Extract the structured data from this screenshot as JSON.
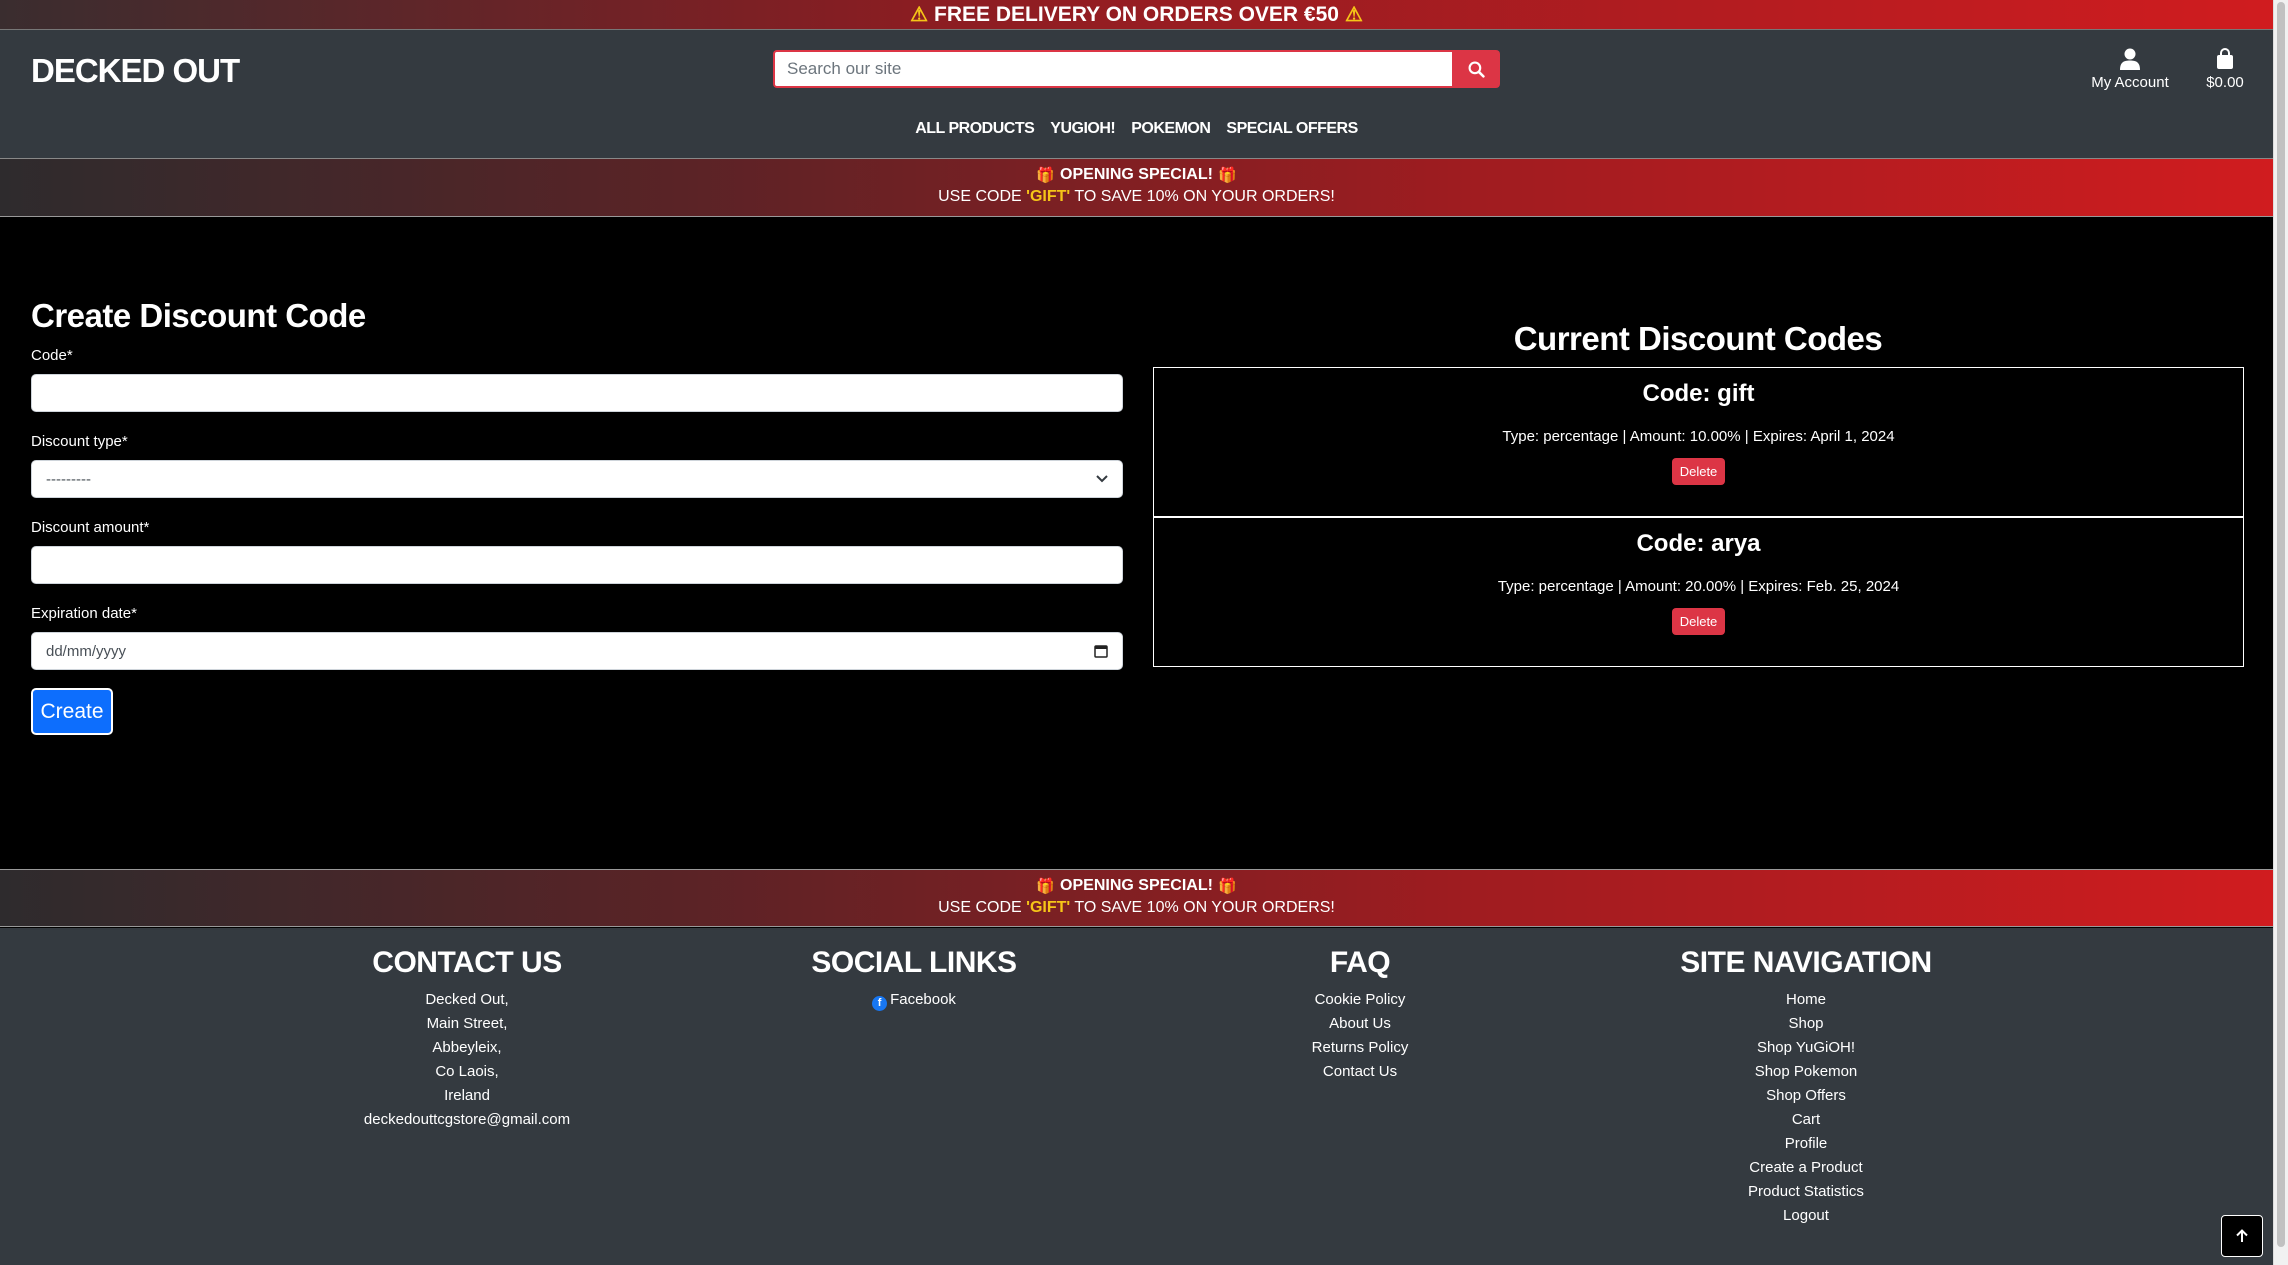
{
  "delivery_bar": {
    "text": "FREE DELIVERY ON ORDERS OVER €50",
    "icon": "warning-icon"
  },
  "header": {
    "logo": "DECKED OUT",
    "search": {
      "placeholder": "Search our site",
      "value": ""
    },
    "account_label": "My Account",
    "cart_total": "$0.00",
    "nav": [
      "ALL PRODUCTS",
      "YUGIOH!",
      "POKEMON",
      "SPECIAL OFFERS"
    ]
  },
  "promo": {
    "title": "OPENING SPECIAL!",
    "pre": "USE CODE ",
    "code": "'GIFT'",
    "post": " TO SAVE 10% ON YOUR ORDERS!"
  },
  "create_form": {
    "title": "Create Discount Code",
    "code_label": "Code*",
    "code_value": "",
    "type_label": "Discount type*",
    "type_selected": "---------",
    "amount_label": "Discount amount*",
    "amount_value": "",
    "date_label": "Expiration date*",
    "date_placeholder": "dd/mm/yyyy",
    "submit_label": "Create"
  },
  "current_codes": {
    "title": "Current Discount Codes",
    "items": [
      {
        "code": "Code: gift",
        "info": "Type: percentage | Amount: 10.00% | Expires: April 1, 2024",
        "delete_label": "Delete"
      },
      {
        "code": "Code: arya",
        "info": "Type: percentage | Amount: 20.00% | Expires: Feb. 25, 2024",
        "delete_label": "Delete"
      }
    ]
  },
  "footer": {
    "contact": {
      "title": "CONTACT US",
      "lines": [
        "Decked Out,",
        "Main Street,",
        "Abbeyleix,",
        "Co Laois,",
        "Ireland",
        "deckedouttcgstore@gmail.com"
      ]
    },
    "social": {
      "title": "SOCIAL LINKS",
      "links": [
        "Facebook"
      ]
    },
    "faq": {
      "title": "FAQ",
      "links": [
        "Cookie Policy",
        "About Us",
        "Returns Policy",
        "Contact Us"
      ]
    },
    "site_nav": {
      "title": "SITE NAVIGATION",
      "links": [
        "Home",
        "Shop",
        "Shop YuGiOH!",
        "Shop Pokemon",
        "Shop Offers",
        "Cart",
        "Profile",
        "Create a Product",
        "Product Statistics",
        "Logout"
      ]
    }
  },
  "colors": {
    "accent_red": "#dc3545",
    "primary_blue": "#0d6efd",
    "header_bg": "#343a40",
    "gold": "#f5c518"
  }
}
